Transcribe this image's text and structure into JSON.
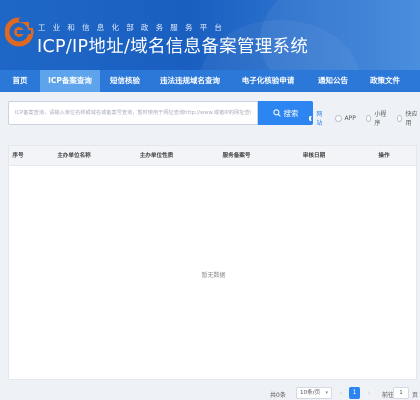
{
  "header": {
    "subtitle": "工业和信息化部政务服务平台",
    "title": "ICP/IP地址/域名信息备案管理系统"
  },
  "nav": {
    "items": [
      {
        "label": "首页",
        "active": false
      },
      {
        "label": "ICP备案查询",
        "active": true
      },
      {
        "label": "短信核验",
        "active": false
      },
      {
        "label": "违法违规域名查询",
        "active": false
      },
      {
        "label": "电子化核验申请",
        "active": false
      },
      {
        "label": "通知公告",
        "active": false
      },
      {
        "label": "政策文件",
        "active": false
      }
    ]
  },
  "search": {
    "placeholder": "ICP备案查询，请输入单位名称或域名或备案号查询，暂时使用于网址查询http://www.或者IP的网址查询",
    "button_label": "搜索",
    "button_icon": "search-icon",
    "options": [
      {
        "label": "网站",
        "checked": true
      },
      {
        "label": "APP",
        "checked": false
      },
      {
        "label": "小程序",
        "checked": false
      },
      {
        "label": "快应用",
        "checked": false
      }
    ]
  },
  "table": {
    "columns": [
      "序号",
      "主办单位名称",
      "主办单位性质",
      "服务备案号",
      "审核日期",
      "操作"
    ],
    "rows": [],
    "empty_text": "暂无数据"
  },
  "pagination": {
    "total": "共0条",
    "page_size": "10条/页",
    "current_page": "1",
    "goto_label": "前往",
    "goto_value": "1",
    "page_unit": "页"
  },
  "colors": {
    "banner": "#1f67c7",
    "nav": "#2b78d9",
    "nav_active": "#5da4ec",
    "accent": "#2c85f0"
  }
}
